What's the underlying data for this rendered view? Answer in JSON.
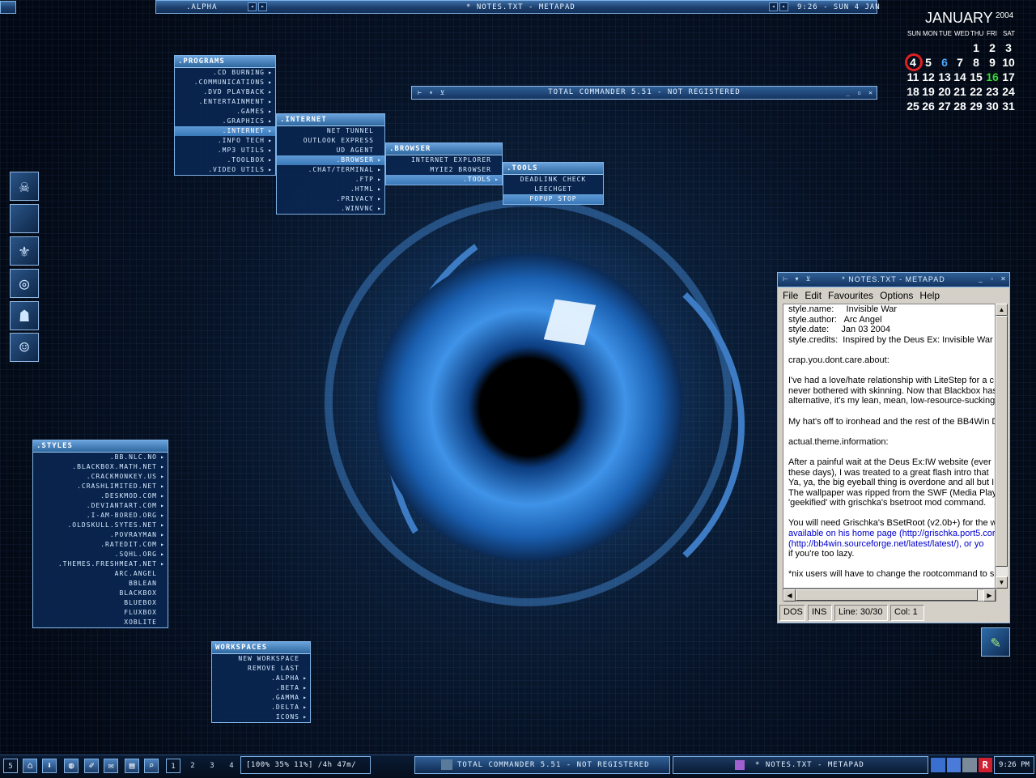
{
  "toolbar": {
    "workspace": ".ALPHA",
    "window_title": "* NOTES.TXT - METAPAD",
    "clock": "9:26 - SUN 4 JAN"
  },
  "calendar": {
    "month": "JANUARY",
    "year": "2004",
    "dow": [
      "SUN",
      "MON",
      "TUE",
      "WED",
      "THU",
      "FRI",
      "SAT"
    ],
    "weeks": [
      [
        "",
        "",
        "",
        "",
        "1",
        "2",
        "3"
      ],
      [
        "4",
        "5",
        "6",
        "7",
        "8",
        "9",
        "10"
      ],
      [
        "11",
        "12",
        "13",
        "14",
        "15",
        "16",
        "17"
      ],
      [
        "18",
        "19",
        "20",
        "21",
        "22",
        "23",
        "24"
      ],
      [
        "25",
        "26",
        "27",
        "28",
        "29",
        "30",
        "31"
      ]
    ],
    "today": "4"
  },
  "menus": {
    "programs": {
      "title": ".PROGRAMS",
      "items": [
        ".CD BURNING",
        ".COMMUNICATIONS",
        ".DVD PLAYBACK",
        ".ENTERTAINMENT",
        ".GAMES",
        ".GRAPHICS",
        ".INTERNET",
        ".INFO TECH",
        ".MP3 UTILS",
        ".TOOLBOX",
        ".VIDEO UTILS"
      ]
    },
    "internet": {
      "title": ".INTERNET",
      "items": [
        "NET TUNNEL",
        "OUTLOOK EXPRESS",
        "UD AGENT",
        ".BROWSER",
        ".CHAT/TERMINAL",
        ".FTP",
        ".HTML",
        ".PRIVACY",
        ".WINVNC"
      ]
    },
    "browser": {
      "title": ".BROWSER",
      "items": [
        "INTERNET EXPLORER",
        "MYIE2 BROWSER",
        ".TOOLS"
      ]
    },
    "tools": {
      "title": ".TOOLS",
      "items": [
        "DEADLINK CHECK",
        "LEECHGET",
        "POPUP STOP"
      ]
    },
    "styles": {
      "title": ".STYLES",
      "items": [
        ".BB.NLC.NO",
        ".BLACKBOX.MATH.NET",
        ".CRACKMONKEY.US",
        ".CRASHLIMITED.NET",
        ".DESKMOD.COM",
        ".DEVIANTART.COM",
        ".I-AM-BORED.ORG",
        ".OLDSKULL.SYTES.NET",
        ".POVRAYMAN",
        ".RATEDIT.COM",
        ".SQHL.ORG",
        ".THEMES.FRESHMEAT.NET",
        "ARC.ANGEL",
        "BBLEAN",
        "BLACKBOX",
        "BLUEBOX",
        "FLUXBOX",
        "XOBLITE"
      ]
    },
    "workspaces": {
      "title": "WORKSPACES",
      "items": [
        "NEW WORKSPACE",
        "REMOVE LAST",
        ".ALPHA",
        ".BETA",
        ".GAMMA",
        ".DELTA",
        "ICONS"
      ]
    }
  },
  "total_commander": {
    "title": "TOTAL COMMANDER 5.51 - NOT REGISTERED"
  },
  "notes": {
    "title": "* NOTES.TXT - METAPAD",
    "menu": [
      "File",
      "Edit",
      "Favourites",
      "Options",
      "Help"
    ],
    "lines": [
      "style.name:     Invisible War",
      "style.author:   Arc Angel",
      "style.date:     Jan 03 2004",
      "style.credits:  Inspired by the Deus Ex: Invisible War",
      "",
      "crap.you.dont.care.about:",
      "",
      "I've had a love/hate relationship with LiteStep for a c",
      "never bothered with skinning. Now that Blackbox has",
      "alternative, it's my lean, mean, low-resource-sucking",
      "",
      "My hat's off to ironhead and the rest of the BB4Win D",
      "",
      "actual.theme.information:",
      "",
      "After a painful wait at the Deus Ex:IW website (ever",
      "these days), I was treated to a great flash intro that",
      "Ya, ya, the big eyeball thing is overdone and all but I",
      "The wallpaper was ripped from the SWF (Media Playe",
      "'geekified' with grischka's bsetroot mod command.",
      "",
      "You will need Grischka's BSetRoot (v2.0b+) for the w",
      "available on his home page (http://grischka.port5.cor",
      "(http://bb4win.sourceforge.net/latest/latest/), or yo",
      "if you're too lazy.",
      "",
      "*nix users will have to change the rootcommand to su"
    ],
    "status": [
      "DOS",
      "INS",
      "Line: 30/30",
      "Col: 1"
    ]
  },
  "taskbar": {
    "workspace_count": "5",
    "workspace_numbers": [
      "1",
      "2",
      "3",
      "4"
    ],
    "stats": "[100% 35% 11%] /4h 47m/",
    "tasks": [
      "TOTAL COMMANDER 5.51 - NOT REGISTERED",
      "* NOTES.TXT - METAPAD"
    ],
    "clock": "9:26 PM"
  }
}
